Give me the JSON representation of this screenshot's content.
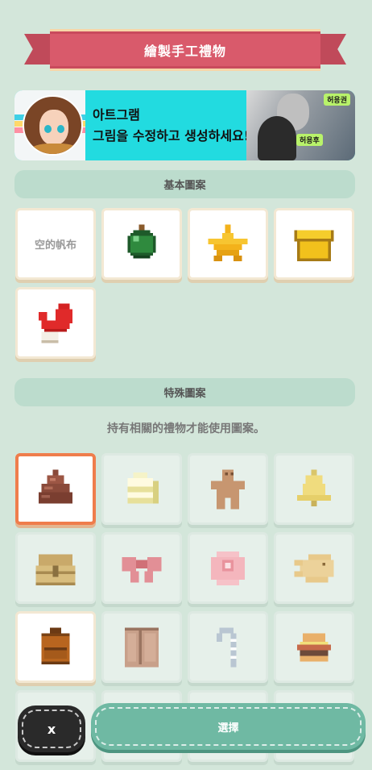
{
  "header": {
    "title": "繪製手工禮物"
  },
  "banner": {
    "app_name": "아트그램",
    "tagline": "그림을 수정하고 생성하세요!",
    "tag_top": "허용권",
    "tag_bottom": "허용후"
  },
  "basic_section": {
    "title": "基本圖案",
    "tiles": [
      {
        "label": "空的帆布",
        "icon": "blank-canvas"
      },
      {
        "icon": "green-ornament-icon"
      },
      {
        "icon": "star-icon"
      },
      {
        "icon": "yellow-box-icon"
      },
      {
        "icon": "red-mitten-icon"
      }
    ]
  },
  "special_section": {
    "title": "特殊圖案",
    "hint": "持有相關的禮物才能使用圖案。",
    "tiles": [
      {
        "icon": "poop-icon",
        "state": "selected"
      },
      {
        "icon": "cake-slice-icon",
        "state": "locked"
      },
      {
        "icon": "gingerbread-man-icon",
        "state": "locked"
      },
      {
        "icon": "bell-icon",
        "state": "locked"
      },
      {
        "icon": "treasure-chest-icon",
        "state": "locked"
      },
      {
        "icon": "ribbon-bow-icon",
        "state": "locked"
      },
      {
        "icon": "rose-icon",
        "state": "locked"
      },
      {
        "icon": "taiyaki-icon",
        "state": "locked"
      },
      {
        "icon": "backpack-icon",
        "state": "unlocked"
      },
      {
        "icon": "wardrobe-icon",
        "state": "locked"
      },
      {
        "icon": "candy-cane-icon",
        "state": "locked"
      },
      {
        "icon": "burger-icon",
        "state": "locked"
      }
    ]
  },
  "buttons": {
    "cancel_label": "x",
    "select_label": "選擇"
  },
  "colors": {
    "background": "#d3e6da",
    "ribbon": "#d95a6b",
    "selected_border": "#ef7d4c",
    "select_button": "#6fb9a3",
    "cancel_button": "#2a2a2a"
  }
}
